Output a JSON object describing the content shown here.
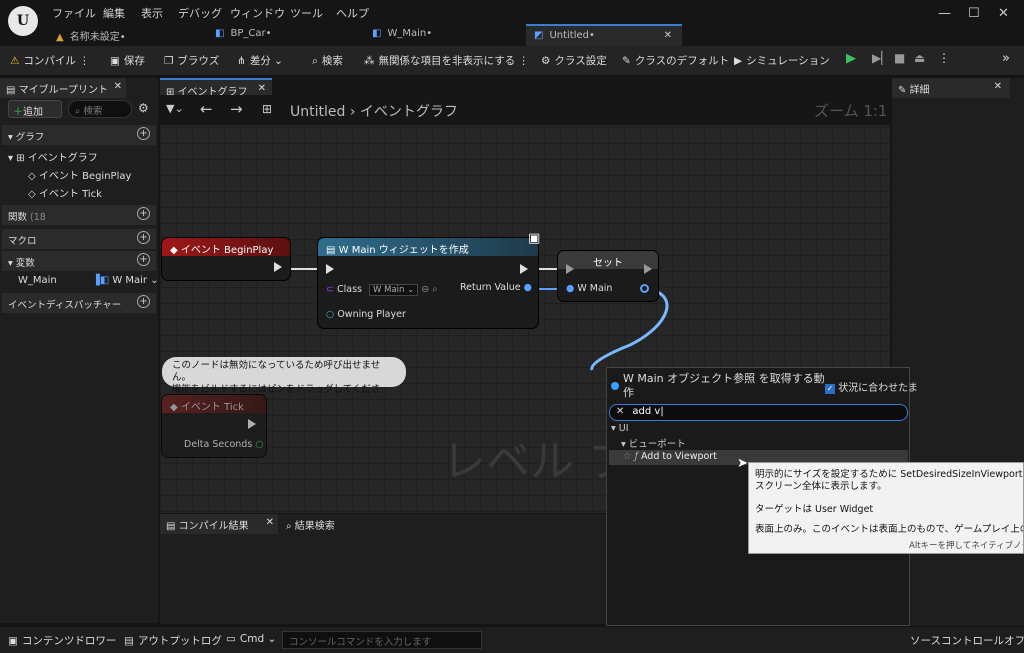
{
  "menu": [
    "ファイル",
    "編集",
    "表示",
    "デバッグ",
    "ウィンドウ",
    "ツール",
    "ヘルプ"
  ],
  "project_tab": "名称未設定•",
  "doc_tabs": [
    "BP_Car•",
    "W_Main•",
    "Untitled•"
  ],
  "toolbar": {
    "compile": "コンパイル",
    "save": "保存",
    "browse": "ブラウズ",
    "diff": "差分",
    "search": "検索",
    "hide_unrelated": "無関係な項目を非表示にする",
    "class_settings": "クラス設定",
    "class_defaults": "クラスのデフォルト",
    "simulation": "シミュレーション"
  },
  "left": {
    "tab": "マイブループリント",
    "add": "追加",
    "search_placeholder": "検索",
    "graph": "グラフ",
    "event_graph": "イベントグラフ",
    "begin_play": "イベント BeginPlay",
    "tick": "イベント Tick",
    "functions": "関数",
    "functions_count": "(18",
    "macros": "マクロ",
    "variables": "変数",
    "var_name": "W_Main",
    "var_type": "W Mair",
    "dispatchers": "イベントディスパッチャー"
  },
  "graph": {
    "tab": "イベントグラフ",
    "breadcrumb_root": "Untitled",
    "breadcrumb_sep": "›",
    "breadcrumb_current": "イベントグラフ",
    "zoom": "ズーム 1:1",
    "watermark": "レベル ブ",
    "node_beginplay": "イベント BeginPlay",
    "node_create": "W Main ウィジェットを作成",
    "pin_class": "Class",
    "pin_class_value": "W Main",
    "pin_owning": "Owning Player",
    "pin_return": "Return Value",
    "node_set": "セット",
    "pin_wmain": "W Main",
    "disabled_line1": "このノードは無効になっているため呼び出せません。",
    "disabled_line2": "機能をビルドするにはピンをドラッグしてください。",
    "node_tick": "イベント Tick",
    "pin_delta": "Delta Seconds"
  },
  "details": {
    "tab": "詳細"
  },
  "bottom": {
    "tab_compile": "コンパイル結果",
    "tab_search": "結果検索"
  },
  "status": {
    "content_drawer": "コンテンツドロワー",
    "output_log": "アウトプットログ",
    "cmd": "Cmd",
    "console_placeholder": "コンソールコマンドを入力します",
    "source_control": "ソースコントロールオフ"
  },
  "popup": {
    "title_line1": "W Main オブジェクト参照 を取得する動",
    "title_line2": "作",
    "context_label": "状況に合わせたま",
    "search_value": "add v",
    "cat_ui": "UI",
    "cat_viewport": "ビューポート",
    "item": "Add to Viewport"
  },
  "tooltip": {
    "line1": "明示的にサイズを設定するために SetDesiredSizeInViewport が呼び出",
    "line2": "スクリーン全体に表示します。",
    "target": "ターゲットは User Widget",
    "cosmetic": "表面上のみ。このイベントは表面上のもので、ゲームプレイ上のアクショ",
    "hint": "Altキーを押してネイティブノード"
  }
}
